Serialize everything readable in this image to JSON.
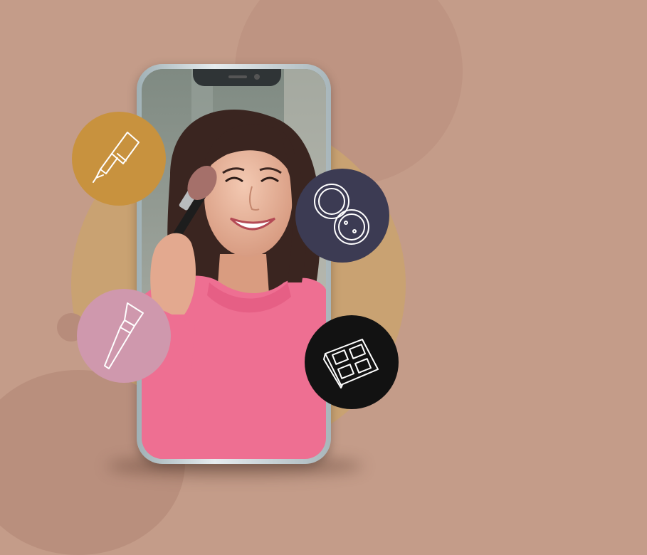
{
  "scene": {
    "subject": "woman-applying-makeup",
    "icons": [
      "lip-gloss-icon",
      "compact-powder-icon",
      "makeup-brush-icon",
      "eyeshadow-palette-icon"
    ]
  },
  "colors": {
    "background": "#c49c89",
    "gold_circle": "#c8923e",
    "navy_circle": "#3c3b53",
    "pink_circle": "#cf98ad",
    "black_circle": "#121212",
    "sweater": "#ee6f92"
  }
}
